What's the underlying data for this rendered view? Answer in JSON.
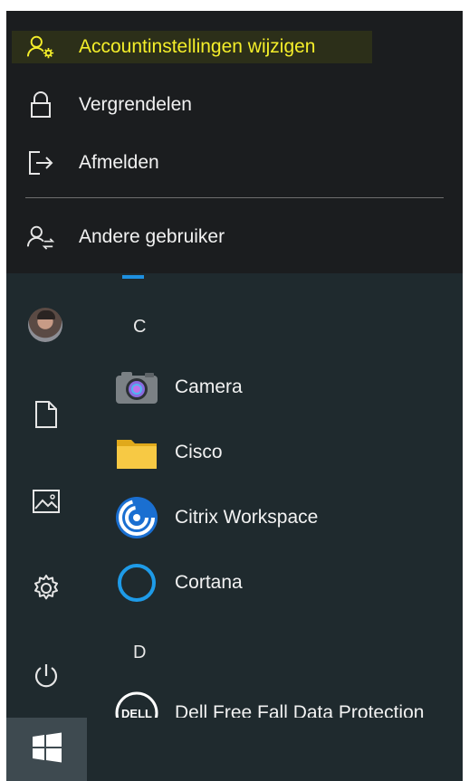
{
  "flyout": {
    "items": [
      {
        "label": "Accountinstellingen wijzigen",
        "icon": "account-settings-icon"
      },
      {
        "label": "Vergrendelen",
        "icon": "lock-icon"
      },
      {
        "label": "Afmelden",
        "icon": "sign-out-icon"
      },
      {
        "label": "Andere gebruiker",
        "icon": "switch-user-icon"
      }
    ],
    "highlight_color": "#f4ee2a"
  },
  "sidebar": {
    "items": [
      "avatar",
      "documents-icon",
      "pictures-icon",
      "settings-icon",
      "power-icon"
    ]
  },
  "app_list": {
    "groups": [
      {
        "letter": "C",
        "apps": [
          {
            "label": "Camera",
            "icon": "camera-icon"
          },
          {
            "label": "Cisco",
            "icon": "folder-icon"
          },
          {
            "label": "Citrix Workspace",
            "icon": "citrix-icon"
          },
          {
            "label": "Cortana",
            "icon": "cortana-icon"
          }
        ]
      },
      {
        "letter": "D",
        "apps": [
          {
            "label": "Dell Free Fall Data Protection",
            "icon": "dell-icon"
          }
        ]
      }
    ]
  },
  "taskbar": {
    "start_icon": "windows-logo-icon"
  }
}
